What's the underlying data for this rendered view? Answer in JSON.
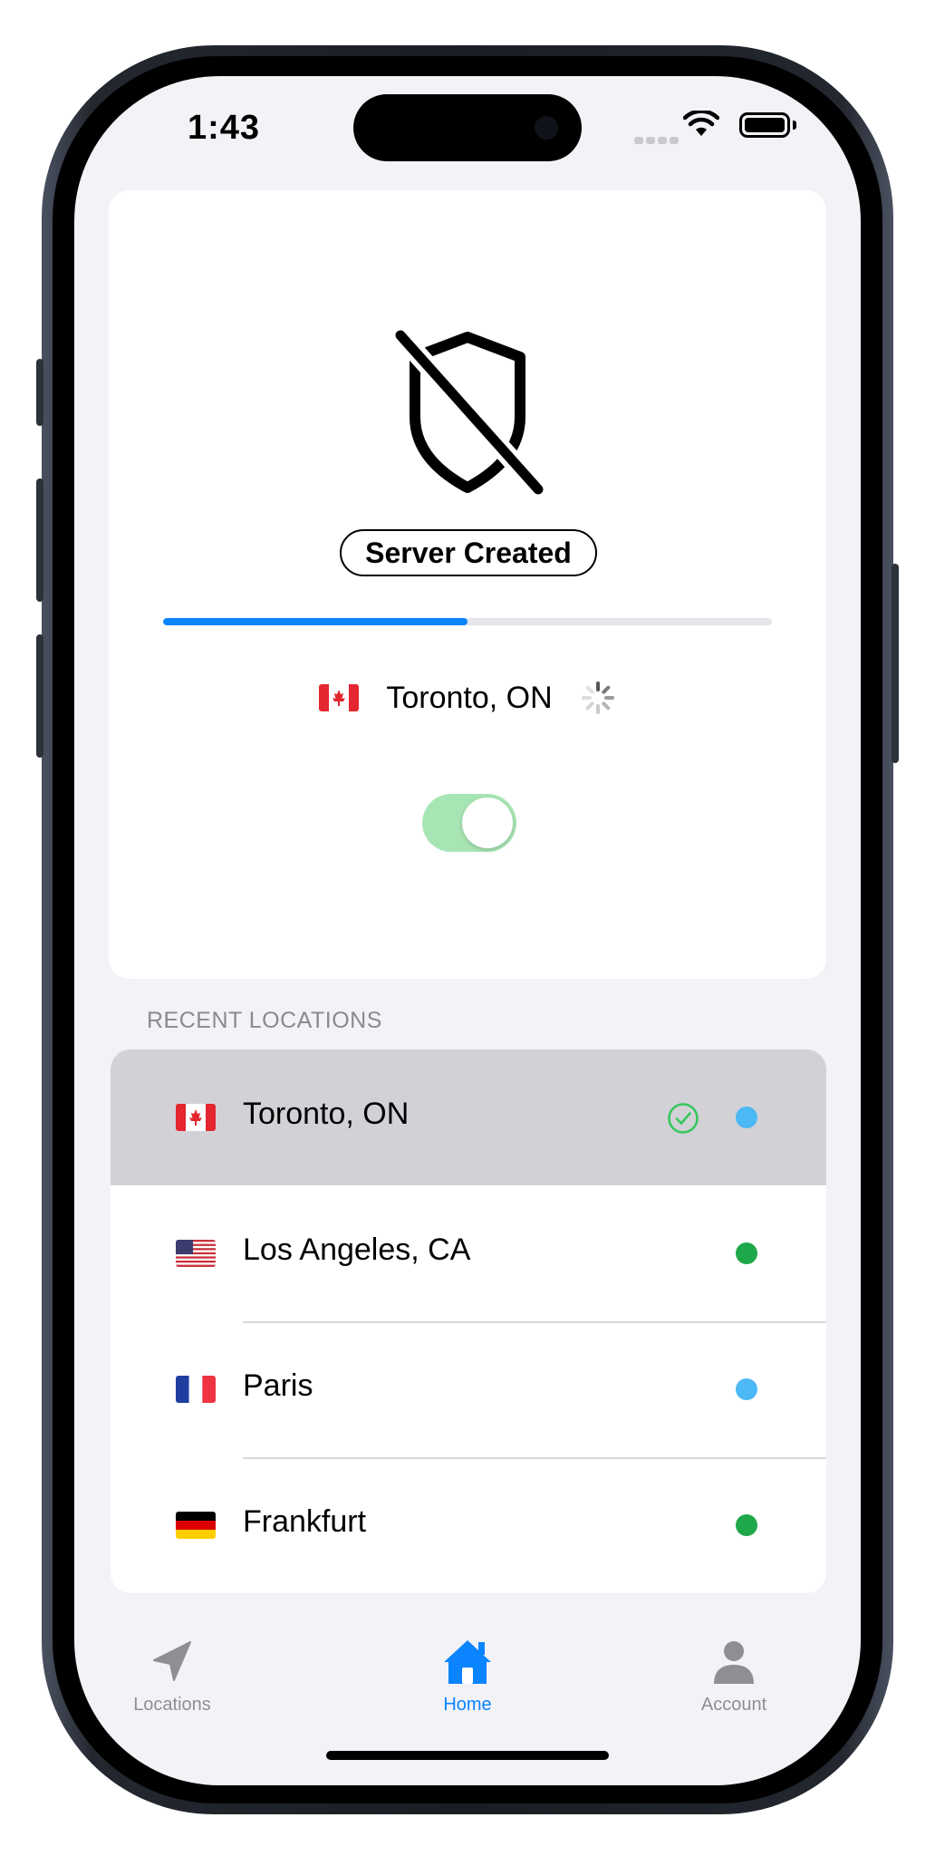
{
  "status_bar": {
    "time": "1:43"
  },
  "connection": {
    "status_label": "Server Created",
    "progress": 0.5,
    "current_location": {
      "name": "Toronto, ON",
      "flag": "canada-flag"
    },
    "toggle_on": true,
    "toggle_color": "#a8e5b4"
  },
  "recent_locations": {
    "header": "RECENT LOCATIONS",
    "items": [
      {
        "name": "Toronto, ON",
        "flag": "canada-flag",
        "selected": true,
        "checked": true,
        "status_color": "#4cb8f5"
      },
      {
        "name": "Los Angeles, CA",
        "flag": "usa-flag",
        "selected": false,
        "checked": false,
        "status_color": "#1fa84a"
      },
      {
        "name": "Paris",
        "flag": "france-flag",
        "selected": false,
        "checked": false,
        "status_color": "#4cb8f5"
      },
      {
        "name": "Frankfurt",
        "flag": "germany-flag",
        "selected": false,
        "checked": false,
        "status_color": "#1fa84a"
      }
    ]
  },
  "tab_bar": {
    "active_color": "#0a84ff",
    "inactive_color": "#8e8e93",
    "tabs": [
      {
        "label": "Locations",
        "icon": "location-arrow-icon",
        "active": false
      },
      {
        "label": "Home",
        "icon": "house-icon",
        "active": true
      },
      {
        "label": "Account",
        "icon": "person-icon",
        "active": false
      }
    ]
  }
}
